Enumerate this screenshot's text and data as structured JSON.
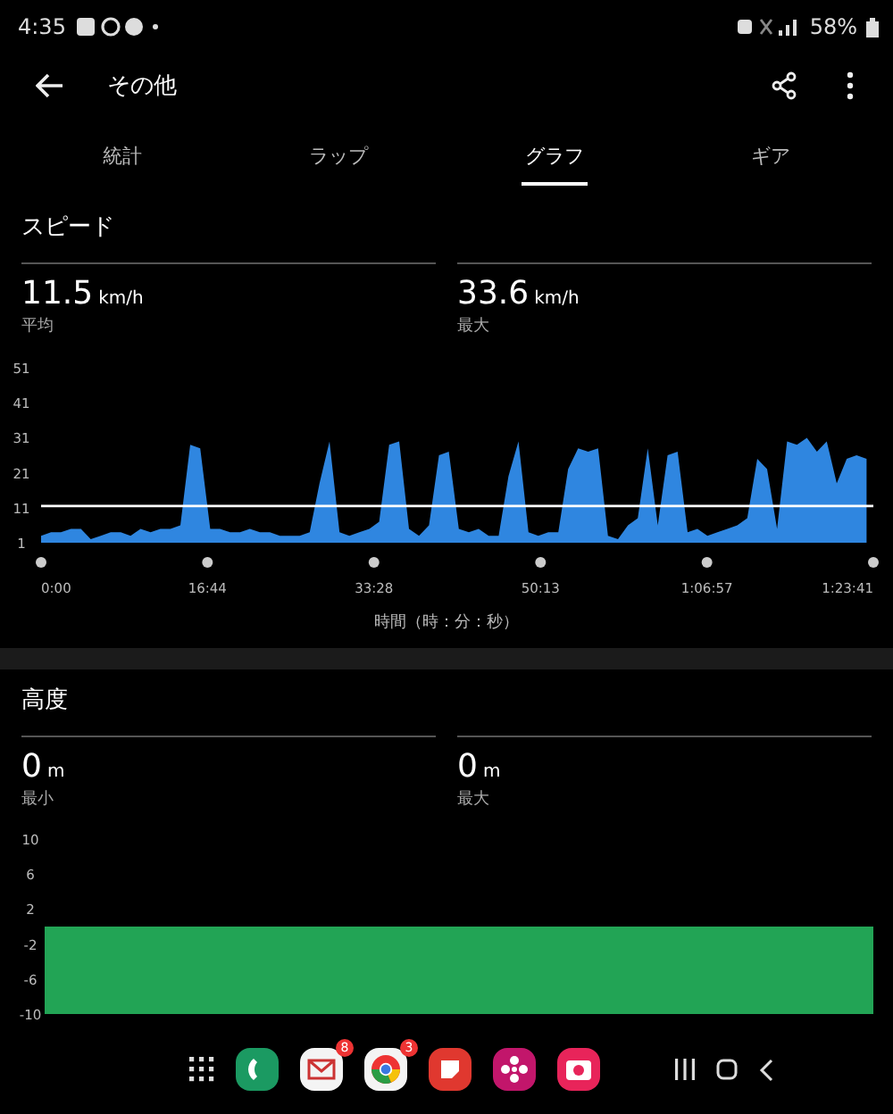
{
  "status_bar": {
    "time": "4:35",
    "battery": "58%"
  },
  "header": {
    "title": "その他"
  },
  "tabs": [
    {
      "label": "統計",
      "selected": false
    },
    {
      "label": "ラップ",
      "selected": false
    },
    {
      "label": "グラフ",
      "selected": true
    },
    {
      "label": "ギア",
      "selected": false
    }
  ],
  "sections": [
    {
      "title": "スピード",
      "stats": [
        {
          "value": "11.5",
          "unit": "km/h",
          "label": "平均"
        },
        {
          "value": "33.6",
          "unit": "km/h",
          "label": "最大"
        }
      ],
      "chart_data": {
        "type": "area",
        "xlabel": "時間（時：分：秒）",
        "x": [
          0,
          1,
          2,
          3,
          4,
          5,
          6,
          7,
          8,
          9,
          10,
          11,
          12,
          13,
          14,
          15,
          16,
          17,
          18,
          19,
          20,
          21,
          22,
          23,
          24,
          25,
          26,
          27,
          28,
          29,
          30,
          31,
          32,
          33,
          34,
          35,
          36,
          37,
          38,
          39,
          40,
          41,
          42,
          43,
          44,
          45,
          46,
          47,
          48,
          49,
          50,
          51,
          52,
          53,
          54,
          55,
          56,
          57,
          58,
          59,
          60,
          61,
          62,
          63,
          64,
          65,
          66,
          67,
          68,
          69,
          70,
          71,
          72,
          73,
          74,
          75,
          76,
          77,
          78,
          79,
          80,
          81,
          82,
          83
        ],
        "series": [
          {
            "color": "#2f86e0",
            "values": [
              3,
              4,
              4,
              5,
              5,
              2,
              3,
              4,
              4,
              3,
              5,
              4,
              5,
              5,
              6,
              29,
              28,
              5,
              5,
              4,
              4,
              5,
              4,
              4,
              3,
              3,
              3,
              4,
              18,
              30,
              4,
              3,
              4,
              5,
              7,
              29,
              30,
              5,
              3,
              6,
              26,
              27,
              5,
              4,
              5,
              3,
              3,
              20,
              30,
              4,
              3,
              4,
              4,
              22,
              28,
              27,
              28,
              3,
              2,
              6,
              8,
              28,
              6,
              26,
              27,
              4,
              5,
              3,
              4,
              5,
              6,
              8,
              25,
              22,
              5,
              30,
              29,
              31,
              27,
              30,
              18,
              25,
              26,
              25
            ]
          }
        ],
        "xlim": [
          0,
          83.68
        ],
        "ylim": [
          1,
          51
        ],
        "xticks": [
          {
            "value": 0,
            "label": "0:00"
          },
          {
            "value": 16.73,
            "label": "16:44"
          },
          {
            "value": 33.47,
            "label": "33:28"
          },
          {
            "value": 50.22,
            "label": "50:13"
          },
          {
            "value": 66.95,
            "label": "1:06:57"
          },
          {
            "value": 83.68,
            "label": "1:23:41"
          }
        ],
        "yticks": [
          51,
          41,
          31,
          21,
          11,
          1
        ],
        "ref_lines": [
          {
            "axis": "y",
            "value": 11.5
          }
        ]
      }
    },
    {
      "title": "高度",
      "stats": [
        {
          "value": "0",
          "unit": "m",
          "label": "最小"
        },
        {
          "value": "0",
          "unit": "m",
          "label": "最大"
        }
      ],
      "chart_data": {
        "type": "area",
        "bands": [
          {
            "axis": "y",
            "from": -10,
            "to": 0,
            "color": "#22a455"
          }
        ],
        "xlim": [
          0,
          83.68
        ],
        "ylim": [
          -10,
          10
        ],
        "yticks": [
          10,
          6,
          2,
          -2,
          -6,
          -10
        ]
      }
    }
  ],
  "dock": {
    "badges": [
      "8",
      "3"
    ]
  }
}
